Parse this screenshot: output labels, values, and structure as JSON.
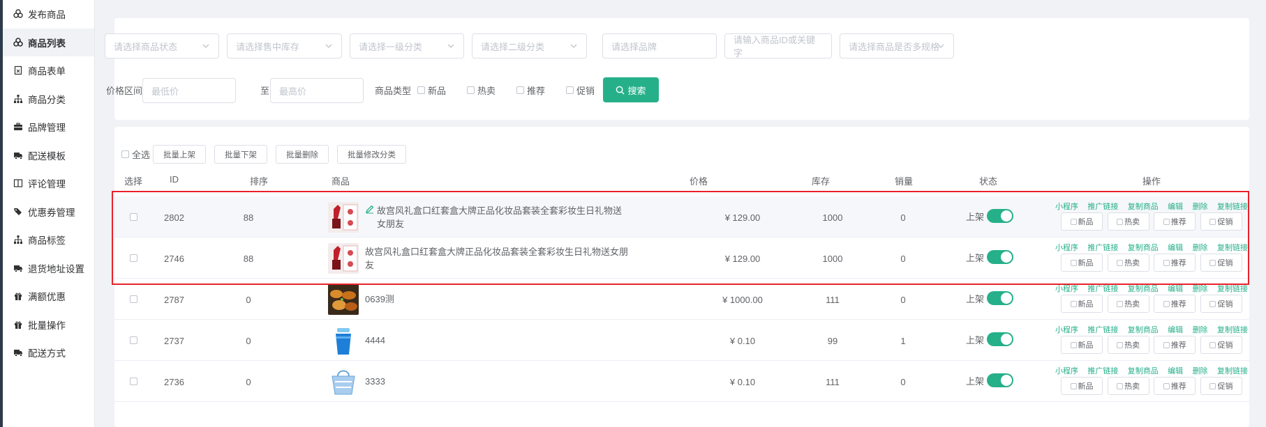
{
  "sidebar": {
    "items": [
      {
        "label": "发布商品",
        "icon": "publish-icon"
      },
      {
        "label": "商品列表",
        "icon": "list-icon",
        "active": true
      },
      {
        "label": "商品表单",
        "icon": "form-icon"
      },
      {
        "label": "商品分类",
        "icon": "category-icon"
      },
      {
        "label": "品牌管理",
        "icon": "brand-icon"
      },
      {
        "label": "配送模板",
        "icon": "truck-icon"
      },
      {
        "label": "评论管理",
        "icon": "comment-icon"
      },
      {
        "label": "优惠券管理",
        "icon": "coupon-icon"
      },
      {
        "label": "商品标签",
        "icon": "tag-icon"
      },
      {
        "label": "退货地址设置",
        "icon": "truck-icon"
      },
      {
        "label": "满额优惠",
        "icon": "gift-icon"
      },
      {
        "label": "批量操作",
        "icon": "gift-icon"
      },
      {
        "label": "配送方式",
        "icon": "truck-icon"
      }
    ]
  },
  "filters": {
    "status_placeholder": "请选择商品状态",
    "stock_placeholder": "请选择售中库存",
    "cat1_placeholder": "请选择一级分类",
    "cat2_placeholder": "请选择二级分类",
    "brand_placeholder": "请选择品牌",
    "keyword_placeholder": "请输入商品ID或关键字",
    "spec_placeholder": "请选择商品是否多规格",
    "price_label": "价格区间",
    "min_placeholder": "最低价",
    "to_label": "至",
    "max_placeholder": "最高价",
    "type_label": "商品类型",
    "types": [
      "新品",
      "热卖",
      "推荐",
      "促销"
    ],
    "search_label": "搜索"
  },
  "batch": {
    "select_all": "全选",
    "buttons": [
      "批量上架",
      "批量下架",
      "批量删除",
      "批量修改分类"
    ]
  },
  "table": {
    "headers": {
      "select": "选择",
      "id": "ID",
      "sort": "排序",
      "product": "商品",
      "price": "价格",
      "stock": "库存",
      "sales": "销量",
      "status": "状态",
      "ops": "操作"
    },
    "ops_links": [
      "小程序",
      "推广链接",
      "复制商品",
      "编辑",
      "删除",
      "复制链接"
    ],
    "ops_tags": [
      "新品",
      "热卖",
      "推荐",
      "促销"
    ],
    "rows": [
      {
        "id": "2802",
        "sort": "88",
        "name": "故宫风礼盒口红套盒大牌正品化妆品套装全套彩妆生日礼物送女朋友",
        "price": "¥ 129.00",
        "stock": "1000",
        "sales": "0",
        "status": "上架",
        "thumb": "lipstick",
        "editable": true
      },
      {
        "id": "2746",
        "sort": "88",
        "name": "故宫风礼盒口红套盒大牌正品化妆品套装全套彩妆生日礼物送女朋友",
        "price": "¥ 129.00",
        "stock": "1000",
        "sales": "0",
        "status": "上架",
        "thumb": "lipstick",
        "editable": false
      },
      {
        "id": "2787",
        "sort": "0",
        "name": "0639测",
        "price": "¥ 1000.00",
        "stock": "111",
        "sales": "0",
        "status": "上架",
        "thumb": "food",
        "editable": false
      },
      {
        "id": "2737",
        "sort": "0",
        "name": "4444",
        "price": "¥ 0.10",
        "stock": "99",
        "sales": "1",
        "status": "上架",
        "thumb": "cup",
        "editable": false
      },
      {
        "id": "2736",
        "sort": "0",
        "name": "3333",
        "price": "¥ 0.10",
        "stock": "111",
        "sales": "0",
        "status": "上架",
        "thumb": "basket",
        "editable": false
      }
    ]
  },
  "colors": {
    "accent": "#26b08a",
    "highlight": "#e8212a"
  }
}
